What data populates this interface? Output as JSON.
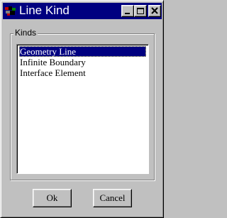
{
  "window": {
    "title": "Line Kind",
    "icon": "app-icon",
    "controls": {
      "minimize": "minimize-icon",
      "maximize": "maximize-icon",
      "close": "close-icon"
    }
  },
  "group": {
    "label": "Kinds"
  },
  "list": {
    "items": [
      "Geometry Line",
      "Infinite Boundary",
      "Interface Element"
    ],
    "selected": "Geometry Line"
  },
  "buttons": {
    "ok": "Ok",
    "cancel": "Cancel"
  },
  "colors": {
    "titlebar": "#000080",
    "selection": "#000080",
    "face": "#c0c0c0"
  }
}
